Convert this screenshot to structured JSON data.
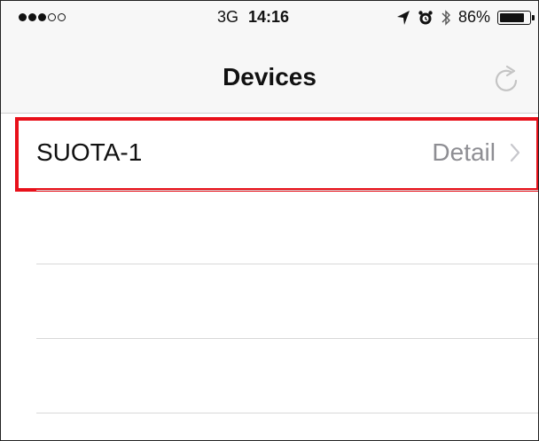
{
  "status_bar": {
    "signal_dots": [
      true,
      true,
      true,
      false,
      false
    ],
    "network": "3G",
    "time": "14:16",
    "icons": [
      "location-arrow-icon",
      "alarm-icon",
      "bluetooth-icon"
    ],
    "battery_percent": "86%",
    "battery_level": 0.86
  },
  "nav": {
    "title": "Devices",
    "refresh_icon": "refresh-icon"
  },
  "devices": [
    {
      "name": "SUOTA-1",
      "detail_label": "Detail",
      "accessory_icon": "chevron-right-icon"
    }
  ],
  "colors": {
    "highlight": "#e8101a",
    "detail_text": "#8e8e93",
    "bar_background": "#f7f7f7"
  }
}
